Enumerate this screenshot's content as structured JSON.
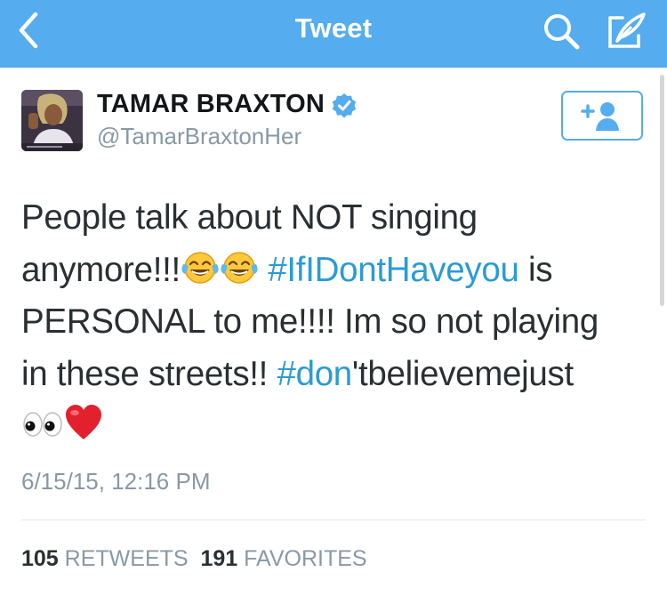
{
  "nav": {
    "title": "Tweet"
  },
  "tweet": {
    "author_name": "TAMAR BRAXTON",
    "author_handle": "@TamarBraxtonHer",
    "text_lines": {
      "l1": "People talk about NOT singing",
      "l2_a": "anymore!!!",
      "l2_hashtag": "#IfIDontHaveyou",
      "l2_b": " is",
      "l3": "PERSONAL to me!!!! Im so not playing",
      "l4_a": "in these streets!! ",
      "l4_hashtag": "#don",
      "l4_b": "'tbelievemejust"
    },
    "timestamp": "6/15/15, 12:16 PM",
    "stats": {
      "retweets_count": "105",
      "retweets_label": "RETWEETS",
      "favorites_count": "191",
      "favorites_label": "FAVORITES"
    }
  },
  "icons": {
    "back": "chevron-left-icon",
    "search": "search-icon",
    "compose": "compose-quill-icon",
    "verified": "verified-badge-icon",
    "follow": "add-user-icon",
    "emoji_laugh": "face-with-tears-of-joy-icon",
    "emoji_eyes": "eyes-icon",
    "emoji_heart": "red-heart-icon"
  },
  "colors": {
    "navbar": "#55acee",
    "link": "#2b9bd3",
    "muted": "#8899a6",
    "text": "#292f33"
  }
}
